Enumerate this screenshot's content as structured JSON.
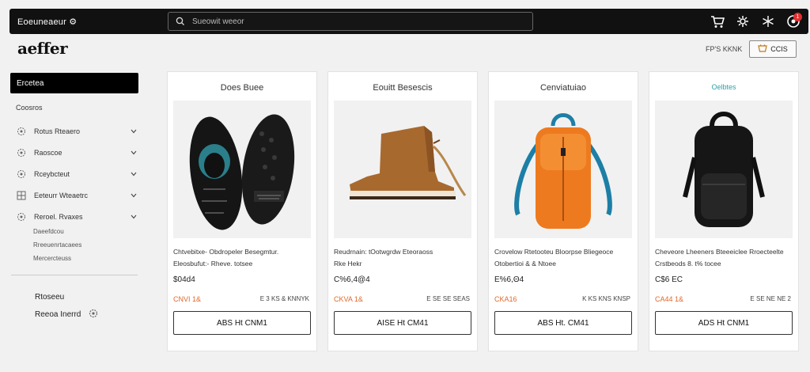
{
  "header": {
    "brand": "Eoeuneaeur ⚙",
    "search_placeholder": "Sueowit weeor",
    "icons": [
      "search-icon",
      "cart-icon",
      "settings-icon",
      "snowflake-icon",
      "user-icon"
    ],
    "notification_count": "1"
  },
  "logo": "aeffer",
  "toolbar": {
    "sort_label": "FP'S KKNK",
    "cart_label": "CCIS"
  },
  "sidebar": {
    "header": "Ercetea",
    "subheader": "Coosros",
    "items": [
      {
        "label": "Rotus Rteaero"
      },
      {
        "label": "Raoscoe"
      },
      {
        "label": "Rceybcteut"
      },
      {
        "label": "Eeteurr Wteaetrc"
      },
      {
        "label": "Reroel. Rvaxes"
      }
    ],
    "subitems": [
      "Daeefdcou",
      "Rreeuenrtacaees",
      "Mercercteuss"
    ],
    "bottom": [
      {
        "label": "Rtoseeu"
      },
      {
        "label": "Reeoa Inerrd"
      }
    ]
  },
  "products": [
    {
      "title": "Does Buee",
      "name": "Chtvebitxe- Obdropeler Besegmtur.",
      "sub": "Eleosbufut:- Rheve. totsee",
      "price": "$04d4",
      "sale": "CNVI 1&",
      "stock": "E 3 KS & KNNYK",
      "button": "ABS Ht CNM1"
    },
    {
      "title": "Eouitt Besescis",
      "name": "Reudrnain: tOotwgrdw Eteoraoss",
      "sub": "Rke  Hekr",
      "price": "C%6,4@4",
      "sale": "CKVA 1&",
      "stock": "E SE SE SEAS",
      "button": "AISE Ht CM41"
    },
    {
      "title": "Cenviatuiao",
      "name": "Crovelow Rtetooteu Bloorpse Bliegeoce",
      "sub": "Otobertioi & & Ntoee",
      "price": "E%6,Θ4",
      "sale": "CKA16",
      "stock": "K KS KNS KNSP",
      "button": "ABS Ht. CM41"
    },
    {
      "title": "Oelbtes",
      "name": "Cheveore Lheeners Bteeeiclee Rroecteelte",
      "sub": "Crstbeods 8. t% tocee",
      "price": "C$6 EC",
      "sale": "CA44 1&",
      "stock": "E SE NE NE 2",
      "button": "ADS Ht CNM1"
    }
  ]
}
